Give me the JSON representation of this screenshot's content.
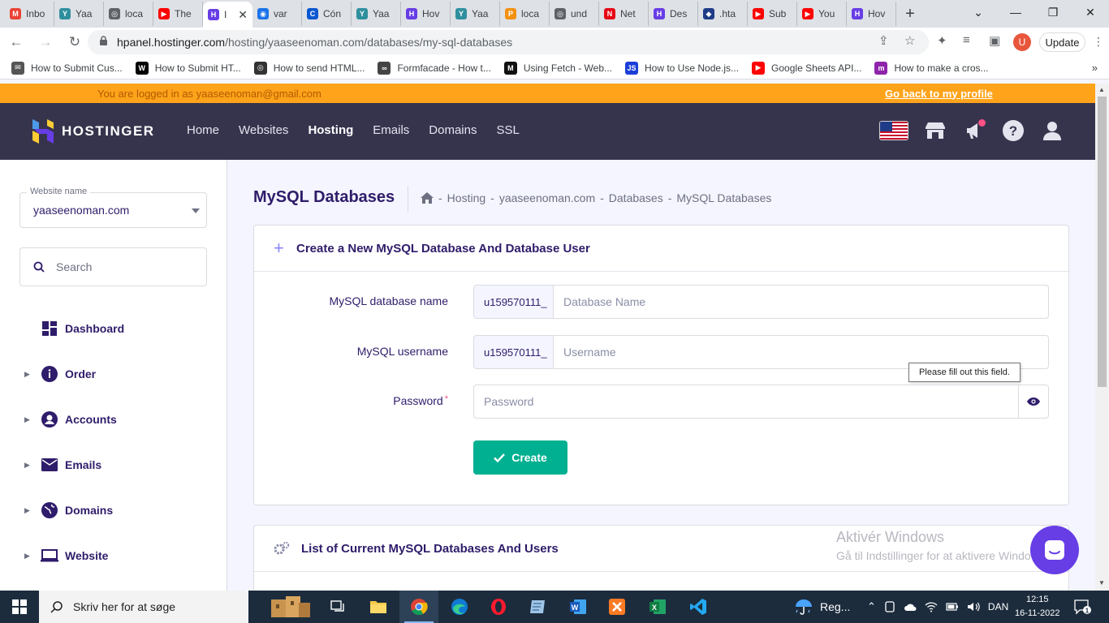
{
  "browser": {
    "tabs": [
      {
        "label": "Inbo",
        "icon": "gmail-icon",
        "color": "#ea4335",
        "glyph": "M"
      },
      {
        "label": "Yaa",
        "icon": "site-icon",
        "color": "#2f8f9d",
        "glyph": "Y"
      },
      {
        "label": "loca",
        "icon": "globe-icon",
        "color": "#5f6368",
        "glyph": "◎"
      },
      {
        "label": "The",
        "icon": "youtube-icon",
        "color": "#ff0000",
        "glyph": "▶"
      },
      {
        "label": "I",
        "icon": "hostinger-icon",
        "color": "#673de6",
        "glyph": "H",
        "active": true
      },
      {
        "label": "var",
        "icon": "site-icon",
        "color": "#1a73e8",
        "glyph": "◉"
      },
      {
        "label": "Cón",
        "icon": "site-icon",
        "color": "#0b57d0",
        "glyph": "C"
      },
      {
        "label": "Yaa",
        "icon": "site-icon",
        "color": "#2f8f9d",
        "glyph": "Y"
      },
      {
        "label": "Hov",
        "icon": "hostinger-icon",
        "color": "#673de6",
        "glyph": "H"
      },
      {
        "label": "Yaa",
        "icon": "site-icon",
        "color": "#2f8f9d",
        "glyph": "Y"
      },
      {
        "label": "loca",
        "icon": "phpmyadmin-icon",
        "color": "#f29111",
        "glyph": "P"
      },
      {
        "label": "und",
        "icon": "globe-icon",
        "color": "#5f6368",
        "glyph": "◎"
      },
      {
        "label": "Net",
        "icon": "netflix-icon",
        "color": "#e50914",
        "glyph": "N"
      },
      {
        "label": "Des",
        "icon": "hostinger-icon",
        "color": "#673de6",
        "glyph": "H"
      },
      {
        "label": ".hta",
        "icon": "site-icon",
        "color": "#1f3c88",
        "glyph": "◆"
      },
      {
        "label": "Sub",
        "icon": "youtube-icon",
        "color": "#ff0000",
        "glyph": "▶"
      },
      {
        "label": "You",
        "icon": "youtube-icon",
        "color": "#ff0000",
        "glyph": "▶"
      },
      {
        "label": "Hov",
        "icon": "hostinger-icon",
        "color": "#673de6",
        "glyph": "H"
      }
    ],
    "url_host": "hpanel.hostinger.com",
    "url_path": "/hosting/yaaseenoman.com/databases/my-sql-databases",
    "profile_initial": "U",
    "update_label": "Update",
    "bookmarks": [
      {
        "label": "How to Submit Cus...",
        "color": "#555555",
        "glyph": "✉"
      },
      {
        "label": "How to Submit HT...",
        "color": "#000000",
        "glyph": "W"
      },
      {
        "label": "How to send HTML...",
        "color": "#333333",
        "glyph": "◎"
      },
      {
        "label": "Formfacade - How t...",
        "color": "#444444",
        "glyph": "∞"
      },
      {
        "label": "Using Fetch - Web...",
        "color": "#111111",
        "glyph": "M"
      },
      {
        "label": "How to Use Node.js...",
        "color": "#1a3ed8",
        "glyph": "JS"
      },
      {
        "label": "Google Sheets API...",
        "color": "#ff0000",
        "glyph": "▶"
      },
      {
        "label": "How to make a cros...",
        "color": "#8e24aa",
        "glyph": "m"
      }
    ]
  },
  "banner": {
    "logged_in": "You are logged in as yaaseenoman@gmail.com",
    "go_back": "Go back to my profile"
  },
  "nav": {
    "brand": "HOSTINGER",
    "links": [
      "Home",
      "Websites",
      "Hosting",
      "Emails",
      "Domains",
      "SSL"
    ],
    "active": "Hosting"
  },
  "sidebar": {
    "website_label": "Website name",
    "website_value": "yaaseenoman.com",
    "search_placeholder": "Search",
    "items": [
      {
        "label": "Dashboard",
        "icon": "dashboard-icon",
        "expandable": false
      },
      {
        "label": "Order",
        "icon": "info-icon",
        "expandable": true
      },
      {
        "label": "Accounts",
        "icon": "account-icon",
        "expandable": true
      },
      {
        "label": "Emails",
        "icon": "email-icon",
        "expandable": true
      },
      {
        "label": "Domains",
        "icon": "globe-icon",
        "expandable": true
      },
      {
        "label": "Website",
        "icon": "laptop-icon",
        "expandable": true
      }
    ]
  },
  "main": {
    "title": "MySQL Databases",
    "breadcrumb": [
      "Hosting",
      "yaaseenoman.com",
      "Databases",
      "MySQL Databases"
    ],
    "create_card": {
      "title": "Create a New MySQL Database And Database User",
      "db_name_label": "MySQL database name",
      "db_prefix": "u159570111_",
      "db_placeholder": "Database Name",
      "user_label": "MySQL username",
      "user_prefix": "u159570111_",
      "user_placeholder": "Username",
      "password_label": "Password",
      "password_placeholder": "Password",
      "create_label": "Create",
      "tooltip": "Please fill out this field."
    },
    "list_card": {
      "title": "List of Current MySQL Databases And Users"
    }
  },
  "windows": {
    "activate_title": "Aktivér Windows",
    "activate_sub": "Gå til Indstillinger for at aktivere Windows.",
    "search_placeholder": "Skriv her for at søge",
    "weather": "Reg...",
    "language": "DAN",
    "time": "12:15",
    "date": "16-11-2022",
    "notifications": "1"
  },
  "colors": {
    "brand": "#673de6",
    "nav_bg": "#36344d",
    "banner": "#ffa31a",
    "success": "#00b090"
  }
}
